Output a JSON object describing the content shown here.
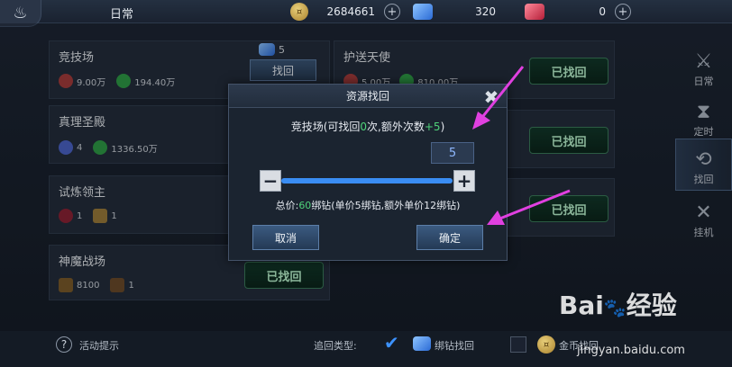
{
  "topbar": {
    "title": "日常",
    "gold_value": "2684661",
    "gem_value": "320",
    "ruby_value": "0"
  },
  "cards": [
    {
      "title": "竞技场",
      "r1": "9.00万",
      "r2": "194.40万",
      "count": "5",
      "button": "找回"
    },
    {
      "title": "护送天使",
      "r1": "5.00万",
      "r2": "810.00万",
      "badge": "已找回"
    },
    {
      "title": "真理圣殿",
      "r1": "4",
      "r2": "1336.50万"
    },
    {
      "title": "",
      "badge": "已找回"
    },
    {
      "title": "试炼领主",
      "r1": "1",
      "r2": "1"
    },
    {
      "title": "",
      "badge": "已找回"
    },
    {
      "title": "神魔战场",
      "r1": "8100",
      "r2": "1",
      "badge": "已找回"
    }
  ],
  "right_nav": [
    {
      "label": "日常",
      "icon": "sword-icon"
    },
    {
      "label": "定时",
      "icon": "hourglass-icon"
    },
    {
      "label": "找回",
      "icon": "recover-icon",
      "active": true
    },
    {
      "label": "挂机",
      "icon": "crossed-swords-icon"
    }
  ],
  "bottom": {
    "help_label": "活动提示",
    "type_label": "追回类型:",
    "option1": "绑钻找回",
    "option2": "金币找回"
  },
  "modal": {
    "title": "资源找回",
    "line_prefix": "竞技场(可找回",
    "line_count": "0",
    "line_mid": "次,额外次数",
    "line_extra": "+5",
    "line_suffix": ")",
    "quantity": "5",
    "total_prefix": "总价:",
    "total_value": "60",
    "total_suffix": "绑钻(单价5绑钻,额外单价12绑钻)",
    "cancel": "取消",
    "confirm": "确定"
  },
  "watermark": {
    "brand": "Bai",
    "brand2": "经验",
    "url": "jingyan.baidu.com"
  },
  "colors": {
    "accent": "#3a8df3",
    "green": "#4fd27a",
    "arrow": "#e040e0"
  }
}
